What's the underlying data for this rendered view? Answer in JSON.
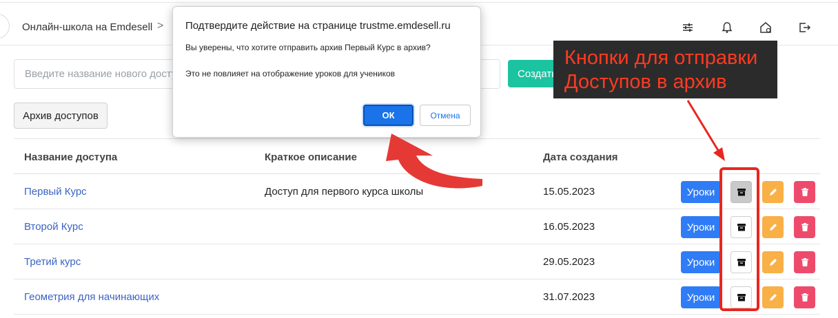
{
  "header": {
    "breadcrumb": "Онлайн-школа на Emdesell",
    "separator": ">",
    "icons": [
      "sliders-icon",
      "bell-icon",
      "home-settings-icon",
      "logout-icon"
    ]
  },
  "new_access": {
    "placeholder": "Введите название нового доступа",
    "create_label": "Создать"
  },
  "archive_button_label": "Архив доступов",
  "table": {
    "headers": {
      "name": "Название доступа",
      "description": "Краткое описание",
      "created": "Дата создания"
    },
    "rows": [
      {
        "name": "Первый Курс",
        "description": "Доступ для первого курса школы",
        "date": "15.05.2023",
        "lessons": "Уроки"
      },
      {
        "name": "Второй Курс",
        "description": "",
        "date": "16.05.2023",
        "lessons": "Уроки"
      },
      {
        "name": "Третий курс",
        "description": "",
        "date": "29.05.2023",
        "lessons": "Уроки"
      },
      {
        "name": "Геометрия для начинающих",
        "description": "",
        "date": "31.07.2023",
        "lessons": "Уроки"
      }
    ]
  },
  "dialog": {
    "title": "Подтвердите действие на странице trustme.emdesell.ru",
    "message": "Вы уверены, что хотите отправить архив Первый Курс в архив?",
    "note": "Это не повлияет на отображение уроков для учеников",
    "ok_label": "ОК",
    "cancel_label": "Отмена"
  },
  "annotation": {
    "line1": "Кнопки для отправки",
    "line2": "Доступов в архив"
  },
  "colors": {
    "accent_green": "#1cc3a0",
    "lessons_blue": "#2f7cf6",
    "edit_orange": "#f9b046",
    "delete_red": "#ee4b6c",
    "link_blue": "#3b63c4",
    "annotation_red": "#e8261f",
    "dialog_ok_blue": "#1a73e8"
  }
}
